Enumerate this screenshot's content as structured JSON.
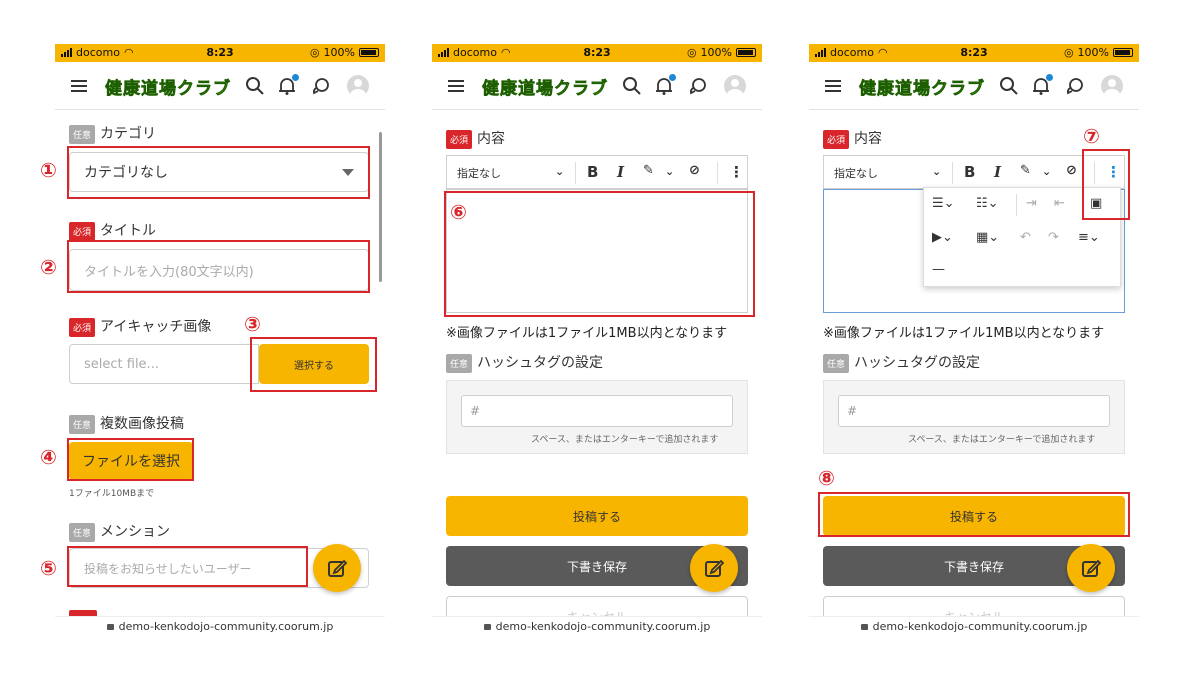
{
  "statusbar": {
    "carrier": "docomo",
    "time": "8:23",
    "battery": "100%"
  },
  "app": {
    "logo": "健康道場クラブ"
  },
  "footer": {
    "url": "demo-kenkodojo-community.coorum.jp"
  },
  "tags": {
    "optional": "任意",
    "required": "必須"
  },
  "panel1": {
    "category_label": "カテゴリ",
    "category_value": "カテゴリなし",
    "title_label": "タイトル",
    "title_placeholder": "タイトルを入力(80文字以内)",
    "eyecatch_label": "アイキャッチ画像",
    "file_placeholder": "select file...",
    "select_button": "選択する",
    "multi_label": "複数画像投稿",
    "choose_file_button": "ファイルを選択",
    "size_note": "1ファイル10MBまで",
    "mention_label": "メンション",
    "mention_placeholder": "投稿をお知らせしたいユーザー"
  },
  "panel2": {
    "content_label": "内容",
    "format_select": "指定なし",
    "image_note": "※画像ファイルは1ファイル1MB以内となります",
    "hashtag_label": "ハッシュタグの設定",
    "hashtag_placeholder": "#",
    "hashtag_hint": "スペース、またはエンターキーで追加されます",
    "post_button": "投稿する",
    "draft_button": "下書き保存",
    "cancel_button": "キャンセル"
  },
  "panel3": {
    "content_label": "内容",
    "format_select": "指定なし",
    "image_note": "※画像ファイルは1ファイル1MB以内となります",
    "hashtag_label": "ハッシュタグの設定",
    "hashtag_placeholder": "#",
    "hashtag_hint": "スペース、またはエンターキーで追加されます",
    "post_button": "投稿する",
    "draft_button": "下書き保存",
    "cancel_button": "キャンセル"
  },
  "annotations": {
    "n1": "①",
    "n2": "②",
    "n3": "③",
    "n4": "④",
    "n5": "⑤",
    "n6": "⑥",
    "n7": "⑦",
    "n8": "⑧"
  },
  "colors": {
    "accent": "#f8b500",
    "required": "#d9262a",
    "annotation": "#d9262a",
    "notification": "#1e88d6"
  },
  "icons": [
    "menu-icon",
    "search-icon",
    "bell-icon",
    "chat-icon",
    "avatar",
    "edit-icon",
    "bold-icon",
    "italic-icon",
    "highlight-icon",
    "link-icon",
    "more-icon",
    "bullet-list-icon",
    "numbered-list-icon",
    "indent-icon",
    "outdent-icon",
    "image-icon",
    "video-icon",
    "table-icon",
    "undo-icon",
    "redo-icon",
    "align-icon",
    "divider-icon",
    "lock-icon"
  ]
}
